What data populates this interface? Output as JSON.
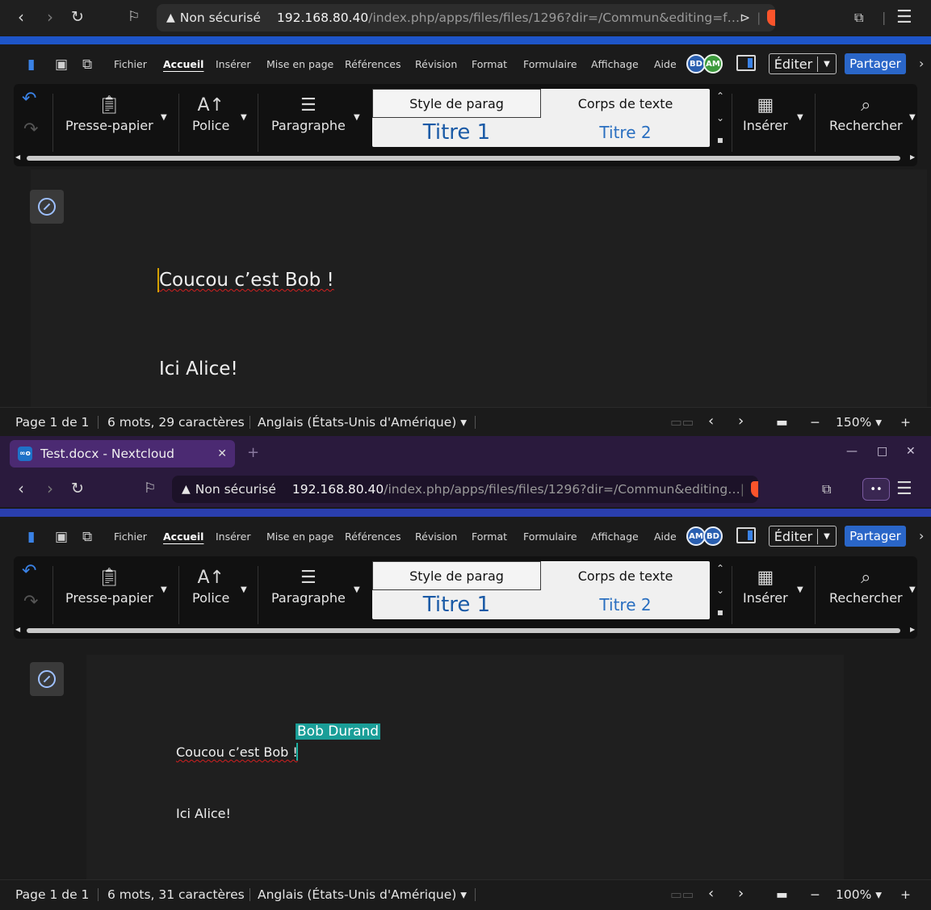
{
  "top": {
    "url": {
      "warning": "Non sécurisé",
      "host": "192.168.80.40",
      "path": "/index.php/apps/files/files/1296?dir=/Commun&editing=f…"
    },
    "avatars": [
      "BD",
      "AM"
    ],
    "doc": {
      "line1": "Coucou c’est Bob !",
      "line2": "Ici Alice!"
    },
    "status": {
      "page": "Page 1 de 1",
      "words": "6 mots, 29 caractères",
      "language": "Anglais (États-Unis d'Amérique)",
      "zoom": "150%"
    }
  },
  "bottom": {
    "tab": {
      "favicon": "∞o",
      "title": "Test.docx - Nextcloud"
    },
    "url": {
      "warning": "Non sécurisé",
      "host": "192.168.80.40",
      "path": "/index.php/apps/files/files/1296?dir=/Commun&editing…"
    },
    "avatars": [
      "AM",
      "BD"
    ],
    "doc": {
      "line1": "Coucou c’est Bob !",
      "line2": "Ici Alice!",
      "collaborator": "Bob Durand"
    },
    "status": {
      "page": "Page 1 de 1",
      "words": "6 mots, 31 caractères",
      "language": "Anglais (États-Unis d'Amérique)",
      "zoom": "100%"
    }
  },
  "menu": {
    "items": [
      "Fichier",
      "Accueil",
      "Insérer",
      "Mise en page",
      "Références",
      "Révision",
      "Format",
      "Formulaire",
      "Affichage",
      "Aide"
    ],
    "edit": "Éditer",
    "share": "Partager"
  },
  "ribbon": {
    "clipboard": "Presse-papier",
    "font": "Police",
    "paragraph": "Paragraphe",
    "styles": [
      "Style de parag",
      "Corps de texte",
      "Titre 1",
      "Titre 2"
    ],
    "insert": "Insérer",
    "search": "Rechercher"
  },
  "colors": {
    "accent_top": "#1e55c8",
    "tab_bar_bottom": "#2a1a3d",
    "share_button": "#2a66c8",
    "collaborator_label": "#1a9e98",
    "undo_icon": "#3a82e6"
  }
}
